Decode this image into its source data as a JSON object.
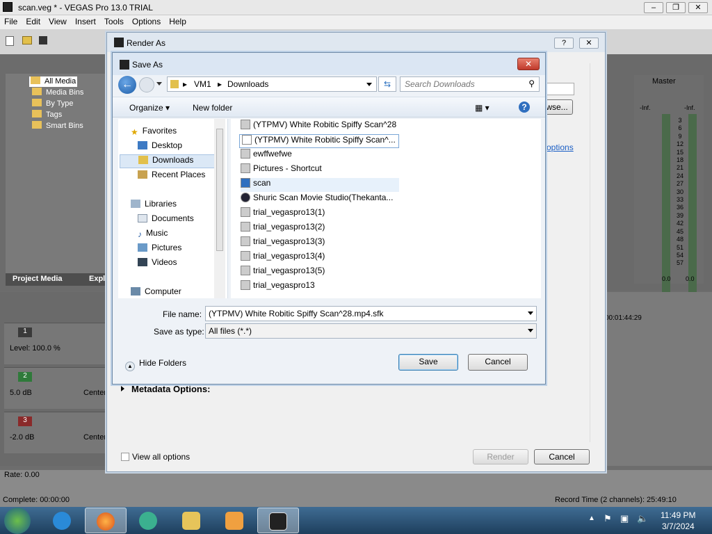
{
  "vegas": {
    "title": "scan.veg * - VEGAS Pro 13.0 TRIAL",
    "menu": [
      "File",
      "Edit",
      "View",
      "Insert",
      "Tools",
      "Options",
      "Help"
    ],
    "media_tree": [
      "All Media",
      "Media Bins",
      "By Type",
      "Tags",
      "Smart Bins"
    ],
    "tab_project_media": "Project Media",
    "tab_explorer": "Explo",
    "level": "Level: 100.0 %",
    "track2_gain": "5.0 dB",
    "track3_gain": "-2.0 dB",
    "center": "Center",
    "rate": "Rate: 0.00",
    "complete": "Complete: 00:00:00",
    "record_time": "Record Time (2 channels): 25:49:10",
    "timecode": "00:01:44:29",
    "mixer_master": "Master",
    "mixer_inf": "-Inf.",
    "mixer_scale": [
      "3",
      "6",
      "9",
      "12",
      "15",
      "18",
      "21",
      "24",
      "27",
      "30",
      "33",
      "36",
      "39",
      "42",
      "45",
      "48",
      "51",
      "54",
      "57"
    ],
    "mixer_zero": "0.0"
  },
  "render_dialog": {
    "title": "Render As",
    "browse_label": "wse...",
    "options_link": "options",
    "metadata_label": "Metadata Options:",
    "view_all_label": "View all options",
    "render_label": "Render",
    "cancel_label": "Cancel"
  },
  "save_dialog": {
    "title": "Save As",
    "breadcrumb": [
      "VM1",
      "Downloads"
    ],
    "search_placeholder": "Search Downloads",
    "organize_label": "Organize",
    "new_folder_label": "New folder",
    "nav": {
      "favorites": "Favorites",
      "desktop": "Desktop",
      "downloads": "Downloads",
      "recent": "Recent Places",
      "libraries": "Libraries",
      "documents": "Documents",
      "music": "Music",
      "pictures": "Pictures",
      "videos": "Videos",
      "computer": "Computer"
    },
    "files": [
      "(YTPMV) White Robitic Spiffy Scan^28",
      "(YTPMV) White Robitic Spiffy Scan^...",
      "ewffwefwe",
      "Pictures - Shortcut",
      "scan",
      "Shuric Scan Movie Studio(Thekanta...",
      "trial_vegaspro13(1)",
      "trial_vegaspro13(2)",
      "trial_vegaspro13(3)",
      "trial_vegaspro13(4)",
      "trial_vegaspro13(5)",
      "trial_vegaspro13"
    ],
    "file_name_label": "File name:",
    "file_name_value": "(YTPMV) White Robitic Spiffy Scan^28.mp4.sfk",
    "save_type_label": "Save as type:",
    "save_type_value": "All files (*.*)",
    "hide_folders_label": "Hide Folders",
    "save_label": "Save",
    "cancel_label": "Cancel"
  },
  "taskbar": {
    "time": "11:49 PM",
    "date": "3/7/2024"
  }
}
